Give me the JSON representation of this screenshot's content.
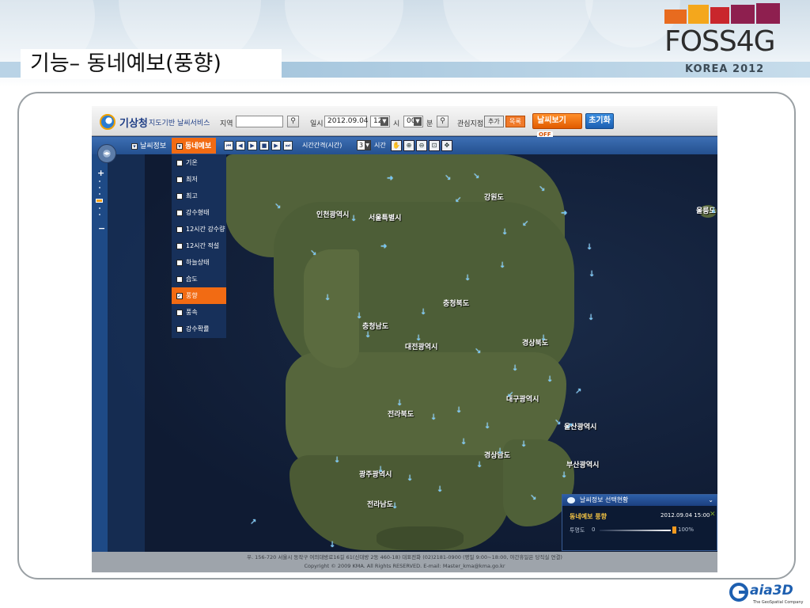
{
  "slide": {
    "title": "기능– 동네예보(풍향)"
  },
  "conference_logo": {
    "name": "FOSS4G",
    "sub": "KOREA 2012",
    "bar_colors": [
      "#e86b1f",
      "#f4a71c",
      "#c9262c",
      "#8e1f4f",
      "#8e1f4f"
    ]
  },
  "app": {
    "brand": "기상청",
    "brand_sub": "지도기반 날씨서비스",
    "toolbar": {
      "region_label": "지역",
      "region_value": "",
      "date_label": "일시",
      "date_value": "2012.09.04",
      "hour_value": "12",
      "hour_unit": "시",
      "minute_value": "00",
      "minute_unit": "분",
      "interest_label": "관심지점",
      "add_label": "추가",
      "list_label": "목록",
      "weather_button": "날씨보기",
      "weather_state": "OFF",
      "reset_button": "초기화"
    },
    "menu": {
      "weather_info": "날씨정보",
      "local_forecast": "동네예보",
      "interval_label": "시간간격(시간)",
      "interval_value": "3",
      "interval_unit": "시간"
    },
    "playback_controls": [
      "first",
      "prev",
      "play",
      "stop",
      "next",
      "last"
    ],
    "tools": [
      "pan",
      "zoom-in",
      "zoom-out",
      "zoom-box",
      "full-extent"
    ],
    "layers": [
      {
        "label": "기온",
        "checked": false
      },
      {
        "label": "최저",
        "checked": false
      },
      {
        "label": "최고",
        "checked": false
      },
      {
        "label": "강수형태",
        "checked": false
      },
      {
        "label": "12시간 강수량",
        "checked": false
      },
      {
        "label": "12시간 적설",
        "checked": false
      },
      {
        "label": "하늘상태",
        "checked": false
      },
      {
        "label": "습도",
        "checked": false
      },
      {
        "label": "풍향",
        "checked": true
      },
      {
        "label": "풍속",
        "checked": false
      },
      {
        "label": "강수확률",
        "checked": false
      }
    ],
    "regions": [
      "강원도",
      "인천광역시",
      "서울특별시",
      "울릉도",
      "충청북도",
      "충청남도",
      "대전광역시",
      "경상북도",
      "대구광역시",
      "전라북도",
      "울산광역시",
      "경상남도",
      "부산광역시",
      "광주광역시",
      "전라남도"
    ],
    "info_panel": {
      "header": "날씨정보 선택현황",
      "title": "동네예보 풍향",
      "datetime": "2012.09.04 15:00",
      "opacity_label": "투명도",
      "opacity_min": "0",
      "opacity_value": "100%",
      "opacity": 1.0
    },
    "footer": {
      "line1": "우. 156-720 서울시 동작구 여의대방로16길 61(신대방 2동 460-18) 대표전화 (02)2181-0900 (평일 9:00~18:00, 야간휴일은 당직실 연결)",
      "line2": "Copyright © 2009 KMA. All Rights RESERVED. E-mail: Master_kma@kma.go.kr"
    }
  },
  "company_logo": {
    "name": "aia3D",
    "sub": "The GeoSpatial Company"
  }
}
